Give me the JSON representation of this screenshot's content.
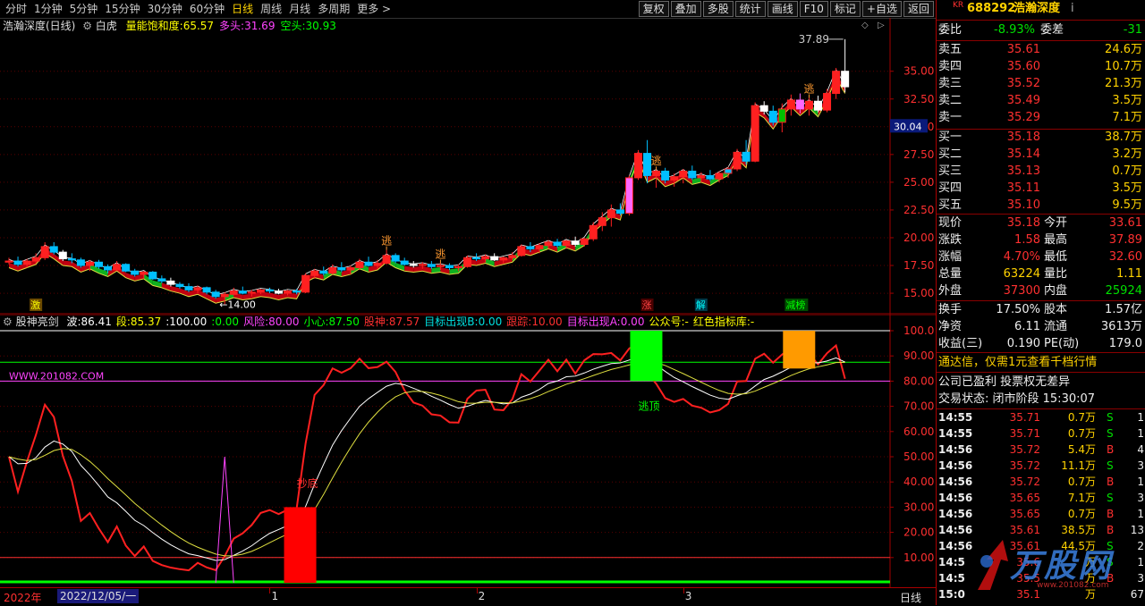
{
  "toolbar": {
    "periods": [
      "分时",
      "1分钟",
      "5分钟",
      "15分钟",
      "30分钟",
      "60分钟",
      "日线",
      "周线",
      "月线",
      "多周期",
      "更多 >"
    ],
    "active_period": "日线",
    "buttons": [
      "复权",
      "叠加",
      "多股",
      "统计",
      "画线",
      "F10",
      "标记",
      "+自选",
      "返回"
    ]
  },
  "main_chart": {
    "title": "浩瀚深度(日线)",
    "indicator": "白虎",
    "metrics": [
      {
        "label": "量能饱和度:",
        "value": "65.57",
        "color": "#ffff00"
      },
      {
        "label": "多头:",
        "value": "31.69",
        "color": "#ff44ff"
      },
      {
        "label": "空头:",
        "value": "30.93",
        "color": "#00ff00"
      }
    ],
    "y_axis": [
      "35.00",
      "32.50",
      "30.00",
      "27.50",
      "25.00",
      "22.50",
      "20.00",
      "17.50",
      "15.00"
    ],
    "y_range": [
      14.2,
      38.6
    ],
    "current_price_tag": "30.04",
    "high_annotation": "37.89",
    "low_annotation": "←14.00",
    "signals": [
      {
        "text": "逃",
        "i": 42
      },
      {
        "text": "逃",
        "i": 48
      },
      {
        "text": "逃",
        "i": 72
      },
      {
        "text": "逃",
        "i": 89
      }
    ],
    "bottom_labels": [
      {
        "text": "激",
        "i": 3,
        "color": "#ffff00",
        "bg": "#6b4a00"
      },
      {
        "text": "涨",
        "i": 71,
        "color": "#ff4444",
        "bg": "#4a0000"
      },
      {
        "text": "解",
        "i": 77,
        "color": "#00ffff",
        "bg": "#003a4a"
      },
      {
        "text": "减榜",
        "i": 87,
        "color": "#00ff00",
        "bg": "#004a00"
      }
    ],
    "candles": [
      [
        17.8,
        18.2,
        17.6,
        17.9
      ],
      [
        17.9,
        18.3,
        17.4,
        17.6
      ],
      [
        17.6,
        18.1,
        17.3,
        17.9
      ],
      [
        17.9,
        18.6,
        17.7,
        18.2
      ],
      [
        18.2,
        19.6,
        18.0,
        19.2
      ],
      [
        19.2,
        19.6,
        18.5,
        18.7
      ],
      [
        18.7,
        18.9,
        17.9,
        18.1
      ],
      [
        18.1,
        18.6,
        17.7,
        18.0
      ],
      [
        18.0,
        18.2,
        17.3,
        17.5
      ],
      [
        17.5,
        18.0,
        17.0,
        17.8
      ],
      [
        17.8,
        18.0,
        17.2,
        17.4
      ],
      [
        17.4,
        17.6,
        16.8,
        17.1
      ],
      [
        17.1,
        17.9,
        17.0,
        17.6
      ],
      [
        17.6,
        17.7,
        16.9,
        17.0
      ],
      [
        17.0,
        17.2,
        16.5,
        16.7
      ],
      [
        16.7,
        17.0,
        16.3,
        16.9
      ],
      [
        16.9,
        17.0,
        16.2,
        16.3
      ],
      [
        16.3,
        16.6,
        15.9,
        16.1
      ],
      [
        16.1,
        16.4,
        15.6,
        15.8
      ],
      [
        15.8,
        16.0,
        15.4,
        15.6
      ],
      [
        15.6,
        15.9,
        15.1,
        15.3
      ],
      [
        15.3,
        15.7,
        15.0,
        15.5
      ],
      [
        15.5,
        15.6,
        14.9,
        15.1
      ],
      [
        15.1,
        15.3,
        14.5,
        14.7
      ],
      [
        14.7,
        15.1,
        14.0,
        14.9
      ],
      [
        14.9,
        15.5,
        14.8,
        15.2
      ],
      [
        15.2,
        15.6,
        14.9,
        15.0
      ],
      [
        15.0,
        15.3,
        14.7,
        15.1
      ],
      [
        15.1,
        15.4,
        14.9,
        15.3
      ],
      [
        15.3,
        15.5,
        15.0,
        15.2
      ],
      [
        15.2,
        15.4,
        14.9,
        15.0
      ],
      [
        15.0,
        15.3,
        14.8,
        15.2
      ],
      [
        15.2,
        15.4,
        14.9,
        15.1
      ],
      [
        15.1,
        16.8,
        15.0,
        16.6
      ],
      [
        16.6,
        17.2,
        16.3,
        17.0
      ],
      [
        17.0,
        17.4,
        16.6,
        16.8
      ],
      [
        16.8,
        17.6,
        16.7,
        17.3
      ],
      [
        17.3,
        17.8,
        16.9,
        17.1
      ],
      [
        17.1,
        17.5,
        16.7,
        17.3
      ],
      [
        17.3,
        18.1,
        17.1,
        17.8
      ],
      [
        17.8,
        18.3,
        17.4,
        17.5
      ],
      [
        17.5,
        18.0,
        17.2,
        17.7
      ],
      [
        17.7,
        18.9,
        17.6,
        18.4
      ],
      [
        18.4,
        18.6,
        17.7,
        17.9
      ],
      [
        17.9,
        18.2,
        17.5,
        17.6
      ],
      [
        17.6,
        17.9,
        17.3,
        17.5
      ],
      [
        17.5,
        17.8,
        17.2,
        17.6
      ],
      [
        17.6,
        17.9,
        17.2,
        17.4
      ],
      [
        17.4,
        17.7,
        17.1,
        17.5
      ],
      [
        17.5,
        17.7,
        17.1,
        17.3
      ],
      [
        17.3,
        17.6,
        17.0,
        17.4
      ],
      [
        17.4,
        18.4,
        17.3,
        18.2
      ],
      [
        18.2,
        18.6,
        17.9,
        18.1
      ],
      [
        18.1,
        18.5,
        17.8,
        18.3
      ],
      [
        18.3,
        18.6,
        17.9,
        18.0
      ],
      [
        18.0,
        18.3,
        17.7,
        18.2
      ],
      [
        18.2,
        18.7,
        18.0,
        18.4
      ],
      [
        18.4,
        19.4,
        18.3,
        19.2
      ],
      [
        19.2,
        19.6,
        18.7,
        19.0
      ],
      [
        19.0,
        19.5,
        18.6,
        19.3
      ],
      [
        19.3,
        19.8,
        19.0,
        19.6
      ],
      [
        19.6,
        19.9,
        19.1,
        19.3
      ],
      [
        19.3,
        19.8,
        19.0,
        19.7
      ],
      [
        19.7,
        20.1,
        19.2,
        19.4
      ],
      [
        19.4,
        20.0,
        19.2,
        19.9
      ],
      [
        19.9,
        21.4,
        19.7,
        21.1
      ],
      [
        21.1,
        22.3,
        20.6,
        21.8
      ],
      [
        21.8,
        23.0,
        21.0,
        22.5
      ],
      [
        22.5,
        23.1,
        22.0,
        22.2
      ],
      [
        22.2,
        25.6,
        22.0,
        25.4
      ],
      [
        25.4,
        27.9,
        25.2,
        27.6
      ],
      [
        27.6,
        28.8,
        24.9,
        25.6
      ],
      [
        25.6,
        26.1,
        24.5,
        26.0
      ],
      [
        26.0,
        26.3,
        24.9,
        25.2
      ],
      [
        25.2,
        25.8,
        24.6,
        25.5
      ],
      [
        25.5,
        26.2,
        24.9,
        26.0
      ],
      [
        26.0,
        26.5,
        25.2,
        25.4
      ],
      [
        25.4,
        25.9,
        25.0,
        25.6
      ],
      [
        25.6,
        26.1,
        25.1,
        25.3
      ],
      [
        25.3,
        26.0,
        25.0,
        25.8
      ],
      [
        25.8,
        26.4,
        25.4,
        26.2
      ],
      [
        26.2,
        28.0,
        26.0,
        27.7
      ],
      [
        27.7,
        28.8,
        26.6,
        26.9
      ],
      [
        26.9,
        32.2,
        26.8,
        31.9
      ],
      [
        31.9,
        32.3,
        31.1,
        31.4
      ],
      [
        31.4,
        31.9,
        30.1,
        30.4
      ],
      [
        30.4,
        32.1,
        29.5,
        31.6
      ],
      [
        31.6,
        32.9,
        31.0,
        32.4
      ],
      [
        32.4,
        33.0,
        31.2,
        31.6
      ],
      [
        31.6,
        32.6,
        31.0,
        32.3
      ],
      [
        32.3,
        32.8,
        31.3,
        31.5
      ],
      [
        31.5,
        33.4,
        31.3,
        33.0
      ],
      [
        33.0,
        35.3,
        32.5,
        35.0
      ],
      [
        35.0,
        37.89,
        33.1,
        33.6
      ]
    ],
    "candle_colors_override": {
      "69": "#ff66ff",
      "78": "#00bfff",
      "80": "#00bfff",
      "86": "#00c000",
      "88": "#ff66ff"
    }
  },
  "indicator_panel": {
    "title": "股神亮剑",
    "metrics": [
      {
        "label": "波:",
        "value": "86.41",
        "color": "#ffffff"
      },
      {
        "label": "段:",
        "value": "85.37",
        "color": "#ffff00"
      },
      {
        "label": ":",
        "value": "100.00",
        "color": "#ffffff"
      },
      {
        "label": ":",
        "value": "0.00",
        "color": "#00ff00"
      },
      {
        "label": "风险:",
        "value": "80.00",
        "color": "#ff44ff"
      },
      {
        "label": "小心:",
        "value": "87.50",
        "color": "#00ff00"
      },
      {
        "label": "股神:",
        "value": "87.57",
        "color": "#ff3030"
      },
      {
        "label": "目标出现B:",
        "value": "0.00",
        "color": "#00e0e0"
      },
      {
        "label": "跟踪:",
        "value": "10.00",
        "color": "#ff3030"
      },
      {
        "label": "目标出现A:",
        "value": "0.00",
        "color": "#ff44ff"
      },
      {
        "label": "公众号:",
        "value": "-",
        "color": "#ffff00"
      },
      {
        "label": "红色指标库:",
        "value": "-",
        "color": "#ffff00"
      }
    ],
    "y_axis": [
      "100.0",
      "90.00",
      "80.00",
      "70.00",
      "60.00",
      "50.00",
      "40.00",
      "30.00",
      "20.00",
      "10.00"
    ],
    "watermark": "WWW.201082.COM",
    "signal_bottom": "抄底",
    "signal_top": "逃顶"
  },
  "time_axis": {
    "year": "2022年",
    "cursor_date": "2022/12/05/一",
    "month_labels": [
      {
        "text": "1",
        "i": 29
      },
      {
        "text": "2",
        "i": 52
      },
      {
        "text": "3",
        "i": 75
      }
    ],
    "period_label": "日线"
  },
  "quote": {
    "code": "688292",
    "name": "浩瀚深度",
    "tag": "KR",
    "weibi_label": "委比",
    "weibi": "-8.93%",
    "weicha_label": "委差",
    "weicha": "-31",
    "asks": [
      {
        "label": "卖五",
        "price": "35.61",
        "vol": "24.6万"
      },
      {
        "label": "卖四",
        "price": "35.60",
        "vol": "10.7万"
      },
      {
        "label": "卖三",
        "price": "35.52",
        "vol": "21.3万"
      },
      {
        "label": "卖二",
        "price": "35.49",
        "vol": "3.5万"
      },
      {
        "label": "卖一",
        "price": "35.29",
        "vol": "7.1万"
      }
    ],
    "bids": [
      {
        "label": "买一",
        "price": "35.18",
        "vol": "38.7万"
      },
      {
        "label": "买二",
        "price": "35.14",
        "vol": "3.2万"
      },
      {
        "label": "买三",
        "price": "35.13",
        "vol": "0.7万"
      },
      {
        "label": "买四",
        "price": "35.11",
        "vol": "3.5万"
      },
      {
        "label": "买五",
        "price": "35.10",
        "vol": "9.5万"
      }
    ],
    "stats": [
      {
        "l1": "现价",
        "v1": "35.18",
        "c1": "red",
        "l2": "今开",
        "v2": "33.61",
        "c2": "red"
      },
      {
        "l1": "涨跌",
        "v1": "1.58",
        "c1": "red",
        "l2": "最高",
        "v2": "37.89",
        "c2": "red"
      },
      {
        "l1": "涨幅",
        "v1": "4.70%",
        "c1": "red",
        "l2": "最低",
        "v2": "32.60",
        "c2": "red"
      },
      {
        "l1": "总量",
        "v1": "63224",
        "c1": "yel",
        "l2": "量比",
        "v2": "1.11",
        "c2": "yel"
      },
      {
        "l1": "外盘",
        "v1": "37300",
        "c1": "red",
        "l2": "内盘",
        "v2": "25924",
        "c2": "grn"
      }
    ],
    "stats2": [
      {
        "l1": "换手",
        "v1": "17.50%",
        "l2": "股本",
        "v2": "1.57亿"
      },
      {
        "l1": "净资",
        "v1": "6.11",
        "l2": "流通",
        "v2": "3613万"
      },
      {
        "l1": "收益(三)",
        "v1": "0.190",
        "l2": "PE(动)",
        "v2": "179.0"
      }
    ],
    "ad": "通达信，仅需1元查看千档行情",
    "company_note": "公司已盈利 投票权无差异",
    "trade_status": "交易状态: 闭市阶段 15:30:07",
    "ticks": [
      {
        "t": "14:55",
        "p": "35.71",
        "v": "0.7万",
        "s": "S",
        "n": "1"
      },
      {
        "t": "14:55",
        "p": "35.71",
        "v": "0.7万",
        "s": "S",
        "n": "1"
      },
      {
        "t": "14:56",
        "p": "35.72",
        "v": "5.4万",
        "s": "B",
        "n": "4"
      },
      {
        "t": "14:56",
        "p": "35.72",
        "v": "11.1万",
        "s": "S",
        "n": "3"
      },
      {
        "t": "14:56",
        "p": "35.72",
        "v": "0.7万",
        "s": "B",
        "n": "1"
      },
      {
        "t": "14:56",
        "p": "35.65",
        "v": "7.1万",
        "s": "S",
        "n": "3"
      },
      {
        "t": "14:56",
        "p": "35.65",
        "v": "0.7万",
        "s": "B",
        "n": "1"
      },
      {
        "t": "14:56",
        "p": "35.61",
        "v": "38.5万",
        "s": "B",
        "n": "13"
      },
      {
        "t": "14:56",
        "p": "35.61",
        "v": "44.5万",
        "s": "S",
        "n": "2"
      },
      {
        "t": "14:5",
        "p": "35.6",
        "v": "万",
        "s": "S",
        "n": "1"
      },
      {
        "t": "14:5",
        "p": "35.5",
        "v": "万",
        "s": "B",
        "n": "3"
      },
      {
        "t": "15:0",
        "p": "35.1",
        "v": "万",
        "s": "",
        "n": "67"
      }
    ],
    "logo_text": "万股网",
    "logo_url": "www.201082.com"
  }
}
